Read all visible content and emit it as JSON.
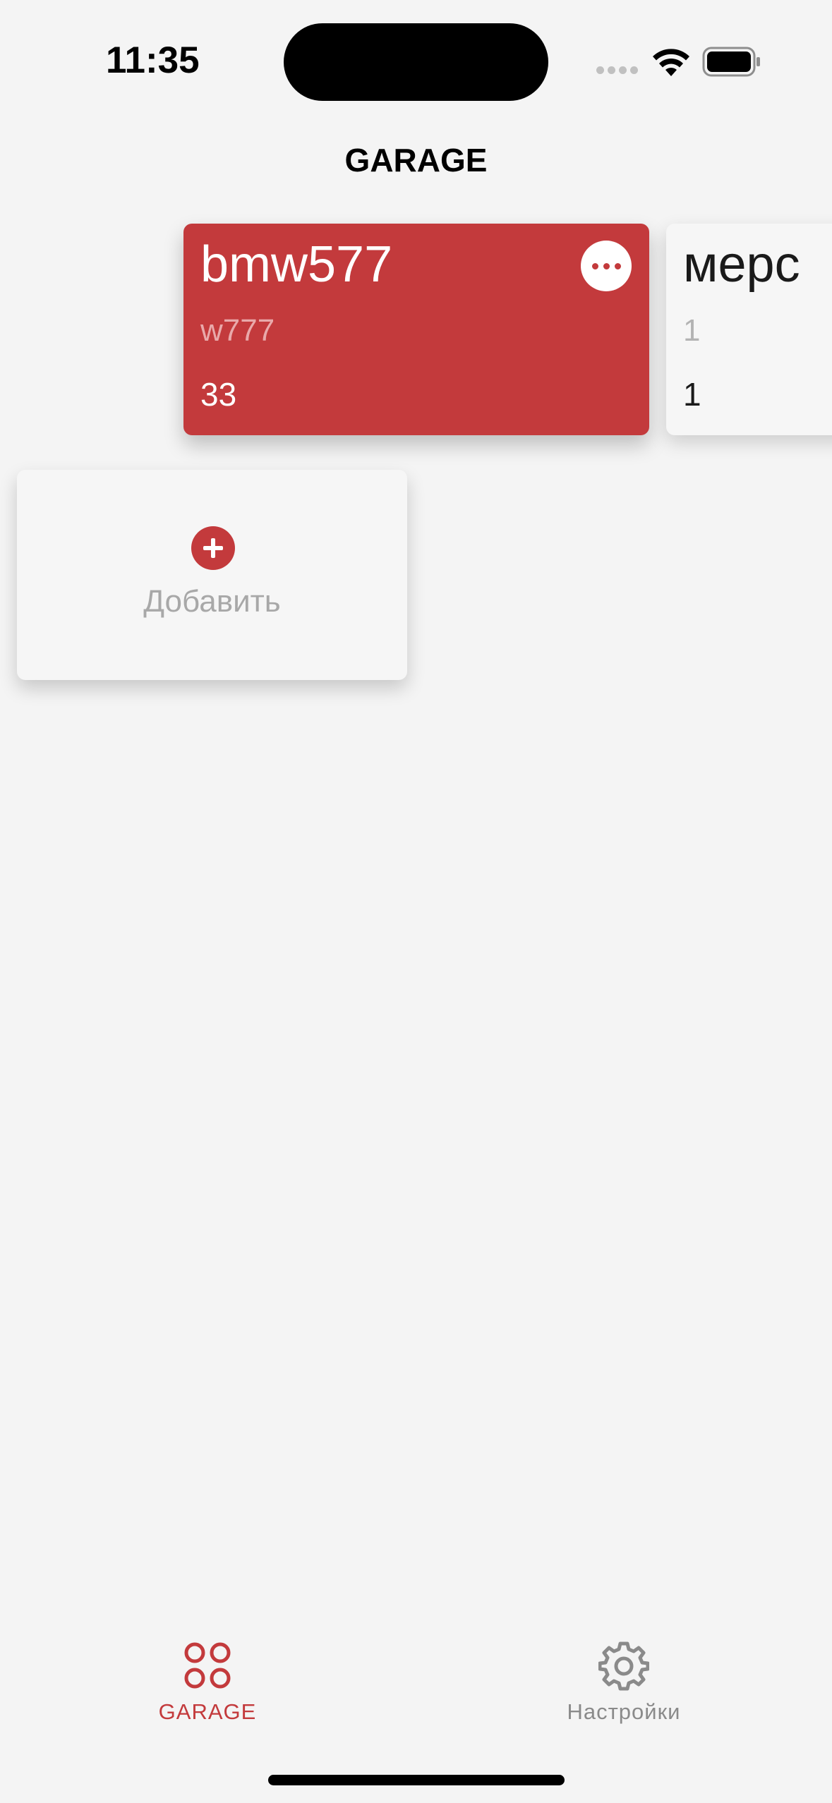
{
  "status_bar": {
    "time": "11:35"
  },
  "header": {
    "title": "GARAGE"
  },
  "cars": [
    {
      "name": "bmw577",
      "plate": "w777",
      "mileage": "33",
      "selected": true
    },
    {
      "name": "мерс",
      "plate": "1",
      "mileage": "1",
      "selected": false
    }
  ],
  "add_card": {
    "label": "Добавить",
    "icon": "plus-circle-icon"
  },
  "tab_bar": {
    "tabs": [
      {
        "label": "GARAGE",
        "icon": "grid-circles-icon",
        "active": true
      },
      {
        "label": "Настройки",
        "icon": "gear-icon",
        "active": false
      }
    ]
  },
  "colors": {
    "accent": "#c33a3c",
    "background": "#f4f4f4",
    "card_background": "#f6f6f6",
    "inactive": "#8a8a8a"
  }
}
